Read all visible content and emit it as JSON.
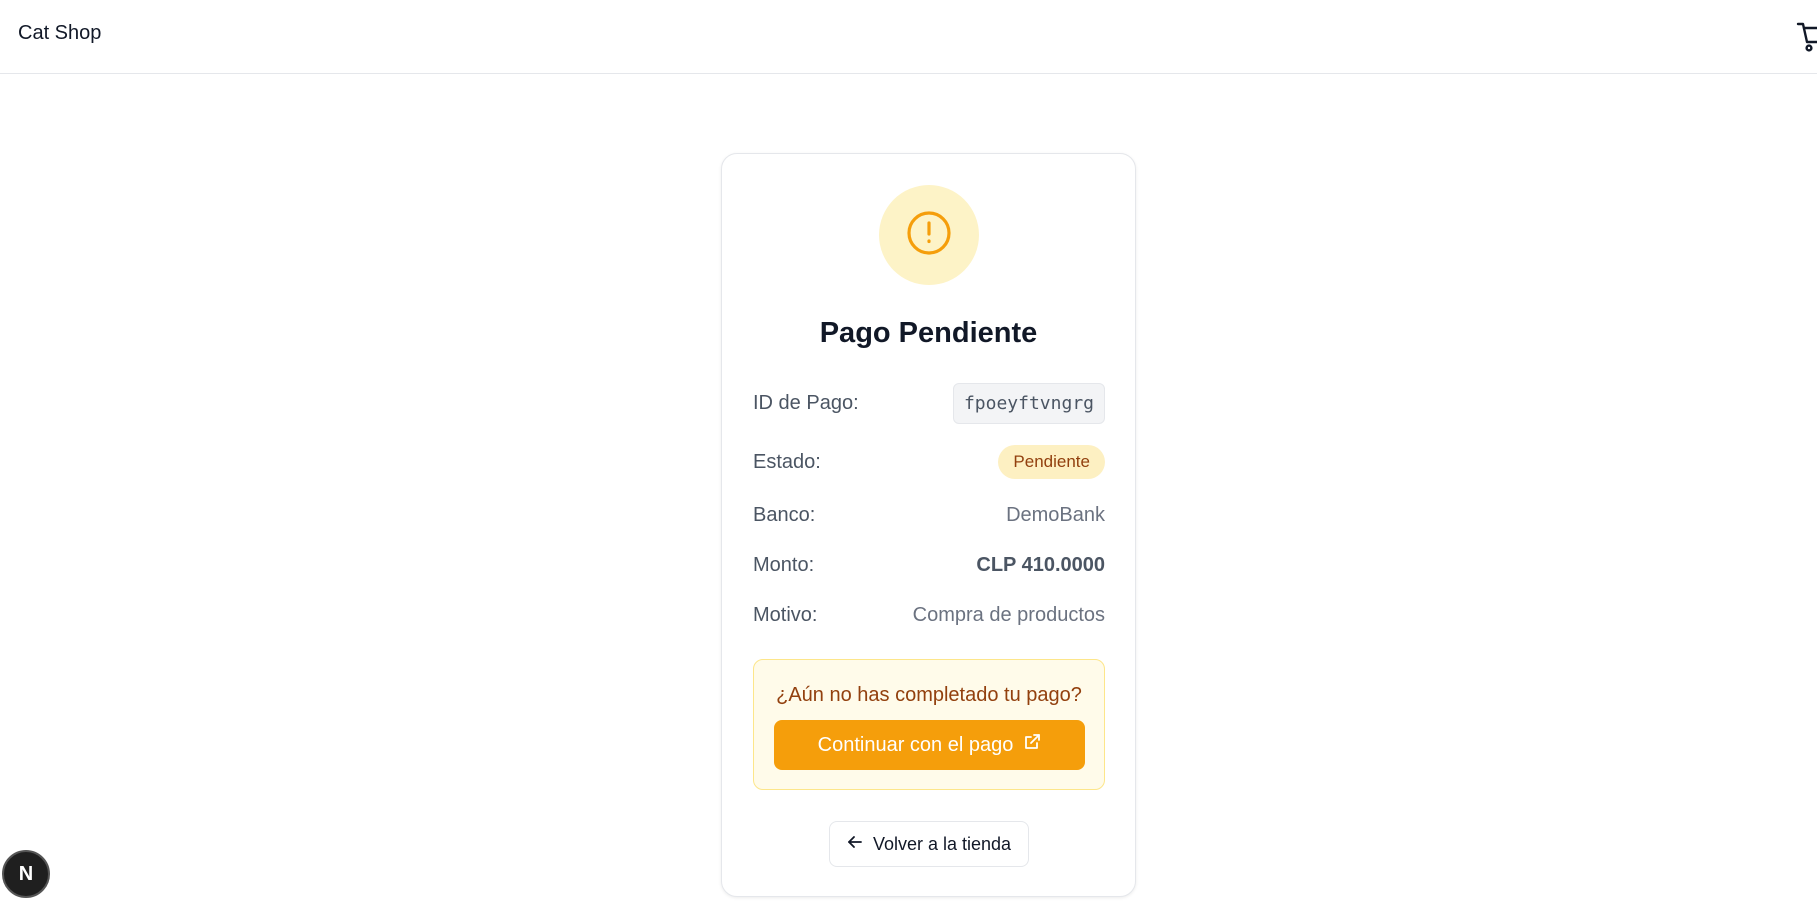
{
  "header": {
    "brand": "Cat Shop",
    "cart_icon": "cart-icon"
  },
  "payment": {
    "status_icon": "alert-circle-icon",
    "accent_color": "#f59e0b",
    "title": "Pago Pendiente",
    "rows": [
      {
        "label": "ID de Pago:",
        "value": "fpoeyftvngrg"
      },
      {
        "label": "Estado:",
        "value": "Pendiente"
      },
      {
        "label": "Banco:",
        "value": "DemoBank"
      },
      {
        "label": "Monto:",
        "value": "CLP 410.0000"
      },
      {
        "label": "Motivo:",
        "value": "Compra de productos"
      }
    ],
    "notice": {
      "text": "¿Aún no has completado tu pago?",
      "button_label": "Continuar con el pago",
      "button_icon": "external-link-icon"
    },
    "back_button": {
      "label": "Volver a la tienda",
      "icon": "arrow-left-icon"
    }
  },
  "dev_badge": {
    "label": "N"
  }
}
